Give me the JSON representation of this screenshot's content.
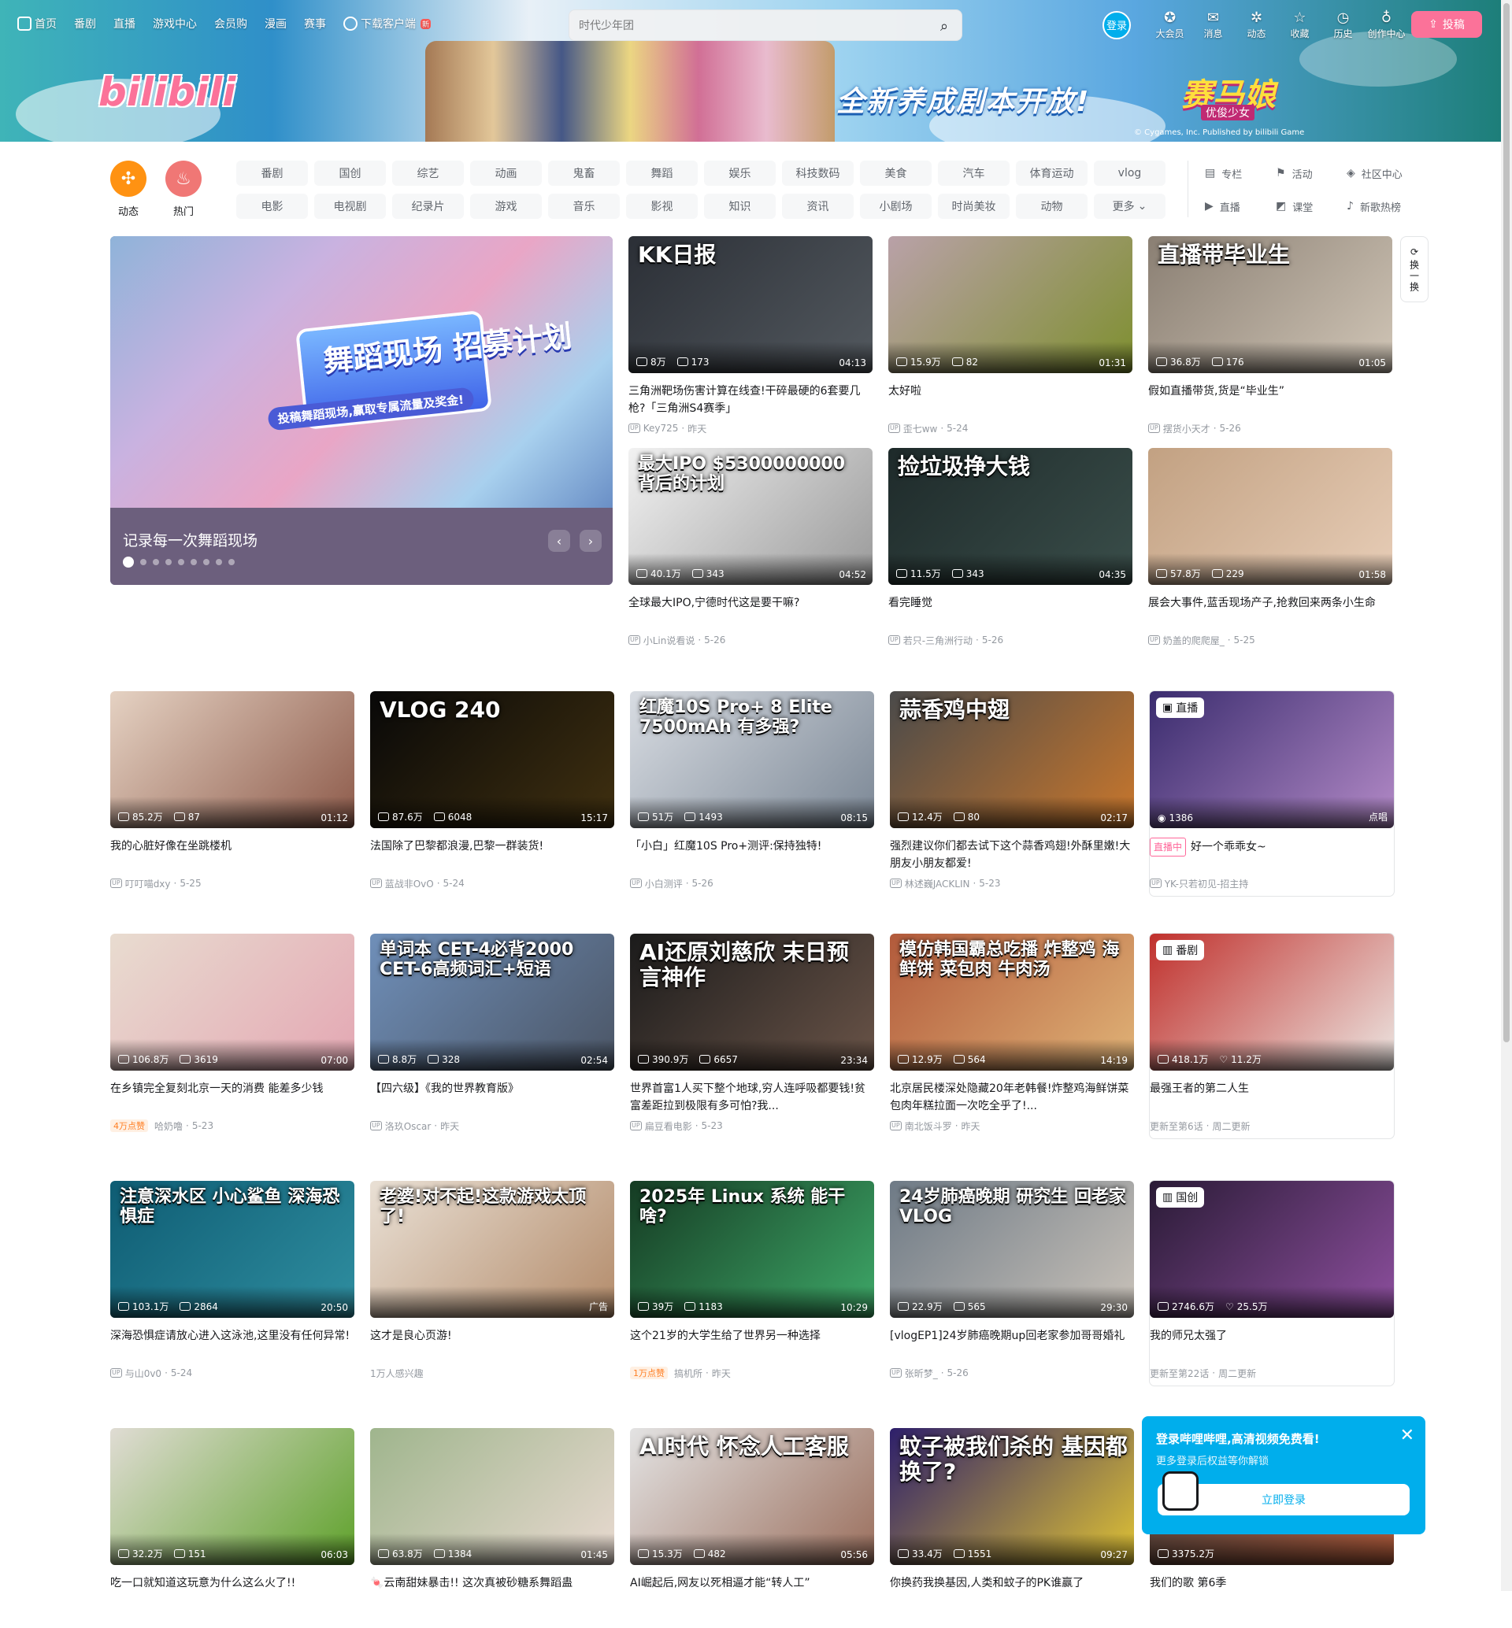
{
  "nav": {
    "items": [
      {
        "label": "首页",
        "icon": "tv-icon"
      },
      {
        "label": "番剧"
      },
      {
        "label": "直播"
      },
      {
        "label": "游戏中心"
      },
      {
        "label": "会员购"
      },
      {
        "label": "漫画"
      },
      {
        "label": "赛事"
      },
      {
        "label": "下载客户端",
        "icon": "download-icon",
        "badge": "新"
      }
    ],
    "search_placeholder": "时代少年团",
    "login": "登录",
    "right": [
      {
        "label": "大会员",
        "icon": "vip-icon",
        "glyph": "✪"
      },
      {
        "label": "消息",
        "icon": "mail-icon",
        "glyph": "✉"
      },
      {
        "label": "动态",
        "icon": "activity-icon",
        "glyph": "✲"
      },
      {
        "label": "收藏",
        "icon": "star-icon",
        "glyph": "☆"
      },
      {
        "label": "历史",
        "icon": "clock-icon",
        "glyph": "◷"
      },
      {
        "label": "创作中心",
        "icon": "bulb-icon",
        "glyph": "♁"
      }
    ],
    "upload": "投稿"
  },
  "banner": {
    "logo": "bilibili",
    "tagline": "全新养成剧本开放!",
    "game_logo": "赛马娘",
    "game_sub": "优俊少女",
    "copyright": "© Cygames, Inc. Published by bilibili Game"
  },
  "channels": {
    "dynamic": "动态",
    "hot": "热门",
    "row1": [
      "番剧",
      "国创",
      "综艺",
      "动画",
      "鬼畜",
      "舞蹈",
      "娱乐",
      "科技数码",
      "美食",
      "汽车",
      "体育运动",
      "vlog"
    ],
    "row2": [
      "电影",
      "电视剧",
      "纪录片",
      "游戏",
      "音乐",
      "影视",
      "知识",
      "资讯",
      "小剧场",
      "时尚美妆",
      "动物",
      "更多"
    ],
    "links": [
      {
        "label": "专栏",
        "glyph": "▤"
      },
      {
        "label": "活动",
        "glyph": "⚑"
      },
      {
        "label": "社区中心",
        "glyph": "◈"
      },
      {
        "label": "直播",
        "glyph": "▶"
      },
      {
        "label": "课堂",
        "glyph": "◩"
      },
      {
        "label": "新歌热榜",
        "glyph": "♪"
      }
    ]
  },
  "carousel": {
    "title": "记录每一次舞蹈现场",
    "art_title": "舞蹈现场 招募计划",
    "art_sub": "投稿舞蹈现场,赢取专属流量及奖金!",
    "dot_count": 9,
    "active_dot": 0
  },
  "refresh": "换一换",
  "cards": [
    {
      "title": "三角洲靶场伤害计算在线查!干碎最硬的6套要几枪?「三角洲S4赛季」",
      "views": "8万",
      "danmaku": "173",
      "duration": "04:13",
      "author": "Key725",
      "date": "昨天",
      "overlay": "KK日报",
      "bg": "#2b2f36,#53595f"
    },
    {
      "title": "太好啦",
      "views": "15.9万",
      "danmaku": "82",
      "duration": "01:31",
      "author": "歪七ww",
      "date": "5-24",
      "overlay": "",
      "bg": "#b9a1a8,#7e8f2f"
    },
    {
      "title": "假如直播带货,货是“毕业生”",
      "views": "36.8万",
      "danmaku": "176",
      "duration": "01:05",
      "author": "摆货小天才",
      "date": "5-26",
      "overlay": "直播带毕业生",
      "bg": "#8a7f73,#d0c5b6"
    },
    {
      "title": "全球最大IPO,宁德时代这是要干嘛?",
      "views": "40.1万",
      "danmaku": "343",
      "duration": "04:52",
      "author": "小Lin说看说",
      "date": "5-26",
      "overlay": "最大IPO $5300000000 背后的计划",
      "bg": "#f2f2f2,#999"
    },
    {
      "title": "看完睡觉",
      "views": "11.5万",
      "danmaku": "343",
      "duration": "04:35",
      "author": "若只-三角洲行动",
      "date": "5-26",
      "overlay": "捡垃圾挣大钱",
      "bg": "#1e2a2a,#3a4e4a"
    },
    {
      "title": "展会大事件,蓝舌现场产子,抢救回来两条小生命",
      "views": "57.8万",
      "danmaku": "229",
      "duration": "01:58",
      "author": "奶盖的爬爬屋_",
      "date": "5-25",
      "overlay": "",
      "bg": "#c2a182,#e7cdb7"
    },
    {
      "title": "我的心脏好像在坐跳楼机",
      "views": "85.2万",
      "danmaku": "87",
      "duration": "01:12",
      "author": "叮叮喵dxy",
      "date": "5-25",
      "overlay": "",
      "bg": "#e5d2c3,#8d5a4a"
    },
    {
      "title": "法国除了巴黎都浪漫,巴黎一群装货!",
      "views": "87.6万",
      "danmaku": "6048",
      "duration": "15:17",
      "author": "蓝战非OvO",
      "date": "5-24",
      "overlay": "VLOG 240",
      "bg": "#080808,#403010"
    },
    {
      "title": "「小白」红魔10S Pro+测评:保持独特!",
      "views": "51万",
      "danmaku": "1493",
      "duration": "08:15",
      "author": "小白测评",
      "date": "5-26",
      "overlay": "红魔10S Pro+ 8 Elite 7500mAh 有多强?",
      "bg": "#d8dce2,#7b8795"
    },
    {
      "title": "强烈建议你们都去试下这个蒜香鸡翅!外酥里嫩!大朋友小朋友都爱!",
      "views": "12.4万",
      "danmaku": "80",
      "duration": "02:17",
      "author": "林述巍JACKLIN",
      "date": "5-23",
      "overlay": "蒜香鸡中翅",
      "bg": "#4a4a4a,#c9772c"
    },
    {
      "live": true,
      "title": "好一个乖乖女~",
      "viewers": "1386",
      "tag": "直播",
      "corner": "点唱",
      "author": "YK-只若初见-招主持",
      "bg": "#3a2c6e,#b38ac7"
    },
    {
      "title": "在乡镇完全复刻北京一天的消费 能差多少钱",
      "views": "106.8万",
      "danmaku": "3619",
      "duration": "07:00",
      "author": "哈奶噜",
      "date": "5-23",
      "hot": "4万点赞",
      "overlay": "",
      "bg": "#e8dcd0,#e4a7b3"
    },
    {
      "title": "【四六级】《我的世界教育版》",
      "views": "8.8万",
      "danmaku": "328",
      "duration": "02:54",
      "author": "洛玖Oscar",
      "date": "昨天",
      "overlay": "单词本 CET-4必背2000 CET-6高频词汇+短语",
      "bg": "#6f8fb9,#4b5565"
    },
    {
      "title": "世界首富1人买下整个地球,穷人连呼吸都要钱!贫富差距拉到极限有多可怕?我...",
      "views": "390.9万",
      "danmaku": "6657",
      "duration": "23:34",
      "author": "扁豆看电影",
      "date": "5-23",
      "overlay": "AI还原刘慈欣 末日预言神作",
      "bg": "#1b1b1b,#6a5448"
    },
    {
      "title": "北京居民楼深处隐藏20年老韩餐!炸整鸡海鲜饼菜包肉年糕拉面一次吃全乎了!...",
      "views": "12.9万",
      "danmaku": "564",
      "duration": "14:19",
      "author": "南北饭斗罗",
      "date": "昨天",
      "overlay": "模仿韩国霸总吃播 炸整鸡 海鲜饼 菜包肉 牛肉汤",
      "bg": "#b25a3b,#e0b377"
    },
    {
      "bangumi": true,
      "title": "最强王者的第二人生",
      "views": "418.1万",
      "likes": "11.2万",
      "tag": "番剧",
      "update": "更新至第6话",
      "day": "周二更新",
      "bg": "#c0302c,#ece6e2"
    },
    {
      "title": "深海恐惧症请放心进入这泳池,这里没有任何异常!",
      "views": "103.1万",
      "danmaku": "2864",
      "duration": "20:50",
      "author": "与山0v0",
      "date": "5-24",
      "overlay": "注意深水区 小心鲨鱼 深海恐惧症",
      "bg": "#0e5c73,#2f8ea0"
    },
    {
      "ad": true,
      "title": "这才是良心页游!",
      "subline": "1万人感兴趣",
      "corner": "广告",
      "overlay": "老婆!对不起!这款游戏太顶了!",
      "bg": "#e9e0d5,#b38b6a"
    },
    {
      "title": "这个21岁的大学生给了世界另一种选择",
      "views": "39万",
      "danmaku": "1183",
      "duration": "10:29",
      "author": "搞机所",
      "date": "昨天",
      "hot": "1万点赞",
      "overlay": "2025年 Linux 系统 能干啥?",
      "bg": "#153b23,#3ea868"
    },
    {
      "title": "[vlogEP1]24岁肺癌晚期up回老家参加哥哥婚礼",
      "views": "22.9万",
      "danmaku": "565",
      "duration": "29:30",
      "author": "张昕梦_",
      "date": "5-26",
      "overlay": "24岁肺癌晚期 研究生 回老家 VLOG",
      "bg": "#6e7a86,#c9c2b9"
    },
    {
      "bangumi": true,
      "title": "我的师兄太强了",
      "views": "2746.6万",
      "likes": "25.5万",
      "tag": "国创",
      "update": "更新至第22话",
      "day": "周二更新",
      "bg": "#2a1b36,#8d4f9e"
    },
    {
      "title": "吃一口就知道这玩意为什么这么火了!!",
      "views": "32.2万",
      "danmaku": "151",
      "duration": "06:03",
      "author": "",
      "date": "",
      "overlay": "",
      "bg": "#e0dcd4,#5ea12a"
    },
    {
      "title": "🍬云南甜妹暴击!! 这次真被砂糖系舞蹈蛊",
      "views": "63.8万",
      "danmaku": "1384",
      "duration": "01:45",
      "author": "",
      "date": "",
      "overlay": "",
      "bg": "#9fb58d,#e8d9d0"
    },
    {
      "title": "AI崛起后,网友以死相逼才能“转人工”",
      "views": "15.3万",
      "danmaku": "482",
      "duration": "05:56",
      "author": "",
      "date": "",
      "overlay": "AI时代 怀念人工客服",
      "bg": "#e3e3e3,#9a6e5c"
    },
    {
      "title": "你换药我换基因,人类和蚊子的PK谁赢了",
      "views": "33.4万",
      "danmaku": "1551",
      "duration": "09:27",
      "author": "",
      "date": "",
      "overlay": "蚊子被我们杀的 基因都换了?",
      "bg": "#2d1f6b,#e0c334"
    },
    {
      "title": "我们的歌 第6季",
      "views": "3375.2万",
      "danmaku": "",
      "duration": "",
      "author": "",
      "date": "",
      "overlay": "",
      "bg": "#3b3b3b,#b05a3a"
    }
  ],
  "login_popup": {
    "title": "登录哔哩哔哩,高清视频免费看!",
    "subtitle": "更多登录后权益等你解锁",
    "button": "立即登录"
  }
}
